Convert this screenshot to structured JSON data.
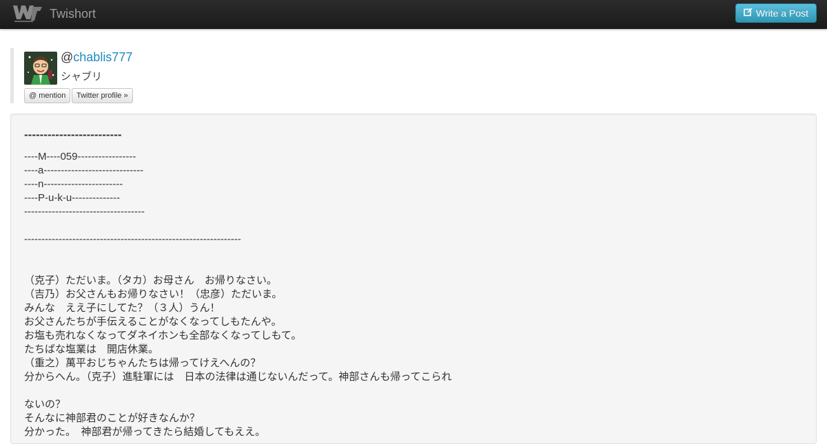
{
  "navbar": {
    "brand_name": "Twishort",
    "write_label": "Write a Post",
    "write_icon": "edit-icon",
    "accent": "#49afcd"
  },
  "profile": {
    "at": "@",
    "username": "chablis777",
    "display_name": "シャブリ",
    "mention_label": "@ mention",
    "twitter_profile_label": "Twitter profile »"
  },
  "post": {
    "heading": "-------------------------",
    "lines": [
      "----M----059-----------------",
      "----a-----------------------------",
      "----n-----------------------",
      "----P-u-k-u--------------",
      "-----------------------------------",
      "",
      "---------------------------------------------------------------",
      "",
      "",
      "（克子）ただいま。（タカ）お母さん　お帰りなさい。",
      "（吉乃）お父さんもお帰りなさい！（忠彦）ただいま。",
      "みんな　ええ子にしてた？（３人）うん！",
      "お父さんたちが手伝えることがなくなってしもたんや。",
      "お塩も売れなくなってダネイホンも全部なくなってしもて。",
      "たちばな塩業は　開店休業。",
      "（重之）萬平おじちゃんたちは帰ってけえへんの？",
      "分からへん。（克子）進駐軍には　日本の法律は通じないんだって。神部さんも帰ってこられ",
      "",
      "ないの？",
      "そんなに神部君のことが好きなんか？",
      "分かった。　神部君が帰ってきたら結婚してもええ。"
    ]
  }
}
